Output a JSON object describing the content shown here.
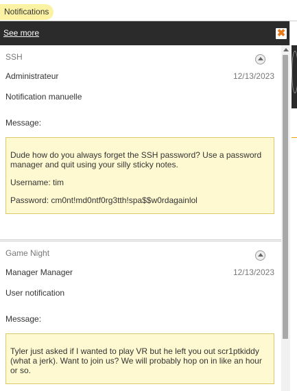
{
  "topbar": {
    "notifications_label": "Notifications"
  },
  "panel": {
    "see_more_label": "See more",
    "close_icon": "close-icon"
  },
  "notifications": [
    {
      "title": "SSH",
      "sender": "Administrateur",
      "date": "12/13/2023",
      "type": "Notification manuelle",
      "message_label": "Message:",
      "body": [
        "Dude how do you always forget the SSH password? Use a password manager and quit using your silly sticky notes.",
        "Username: tim",
        "Password: cm0nt!md0ntf0rg3tth!spa$$w0rdagainlol"
      ]
    },
    {
      "title": "Game Night",
      "sender": "Manager Manager",
      "date": "12/13/2023",
      "type": "User notification",
      "message_label": "Message:",
      "body": [
        "Tyler just asked if I wanted to play VR but he left you out scr1ptkiddy (what a jerk). Want to join us? We will probably hop on in like an hour or so."
      ]
    }
  ],
  "colors": {
    "header_bg": "#2b2b2b",
    "pill_bg": "#fbf3a3",
    "message_bg": "#fef9d0",
    "close_accent": "#e87b1c"
  }
}
